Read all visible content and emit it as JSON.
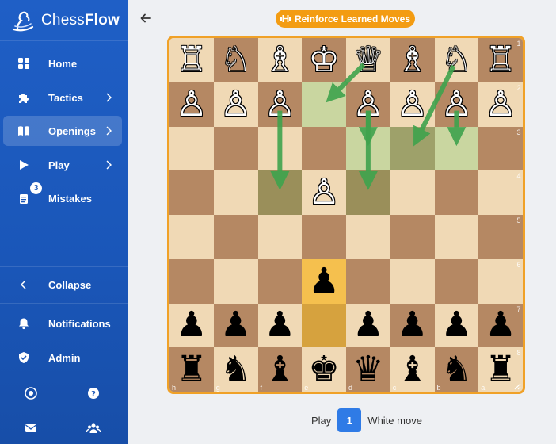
{
  "app": {
    "name_prefix": "Chess",
    "name_suffix": "Flow"
  },
  "sidebar": {
    "items": [
      {
        "label": "Home",
        "icon": "grid-icon"
      },
      {
        "label": "Tactics",
        "icon": "puzzle-icon"
      },
      {
        "label": "Openings",
        "icon": "book-icon",
        "active": true
      },
      {
        "label": "Play",
        "icon": "play-icon"
      },
      {
        "label": "Mistakes",
        "icon": "notes-icon",
        "badge": "3"
      }
    ],
    "collapse_label": "Collapse",
    "notifications_label": "Notifications",
    "admin_label": "Admin"
  },
  "header": {
    "reinforce_label": "Reinforce Learned Moves"
  },
  "board": {
    "rank_labels": [
      "1",
      "2",
      "3",
      "4",
      "5",
      "6",
      "7",
      "8"
    ],
    "file_labels": [
      "h",
      "g",
      "f",
      "e",
      "d",
      "c",
      "b",
      "a"
    ],
    "rows": [
      [
        "♖",
        "♘",
        "♗",
        "♔",
        "♕",
        "♗",
        "♘",
        "♖"
      ],
      [
        "♙",
        "♙",
        "♙",
        "",
        "♙",
        "♙",
        "♙",
        "♙"
      ],
      [
        "",
        "",
        "",
        "",
        "",
        "",
        "",
        ""
      ],
      [
        "",
        "",
        "",
        "♙",
        "",
        "",
        "",
        ""
      ],
      [
        "",
        "",
        "",
        "",
        "",
        "",
        "",
        ""
      ],
      [
        "",
        "",
        "",
        "♟",
        "",
        "",
        "",
        ""
      ],
      [
        "♟",
        "♟",
        "♟",
        "",
        "♟",
        "♟",
        "♟",
        "♟"
      ],
      [
        "♜",
        "♞",
        "♝",
        "♚",
        "♛",
        "♝",
        "♞",
        "♜"
      ]
    ],
    "light_color": "#f0d9b5",
    "dark_color": "#b58863",
    "accent_border": "#f0a127",
    "arrow_color": "#3fa34d"
  },
  "footer": {
    "play_label": "Play",
    "move_number": "1",
    "side_label": "White move"
  }
}
